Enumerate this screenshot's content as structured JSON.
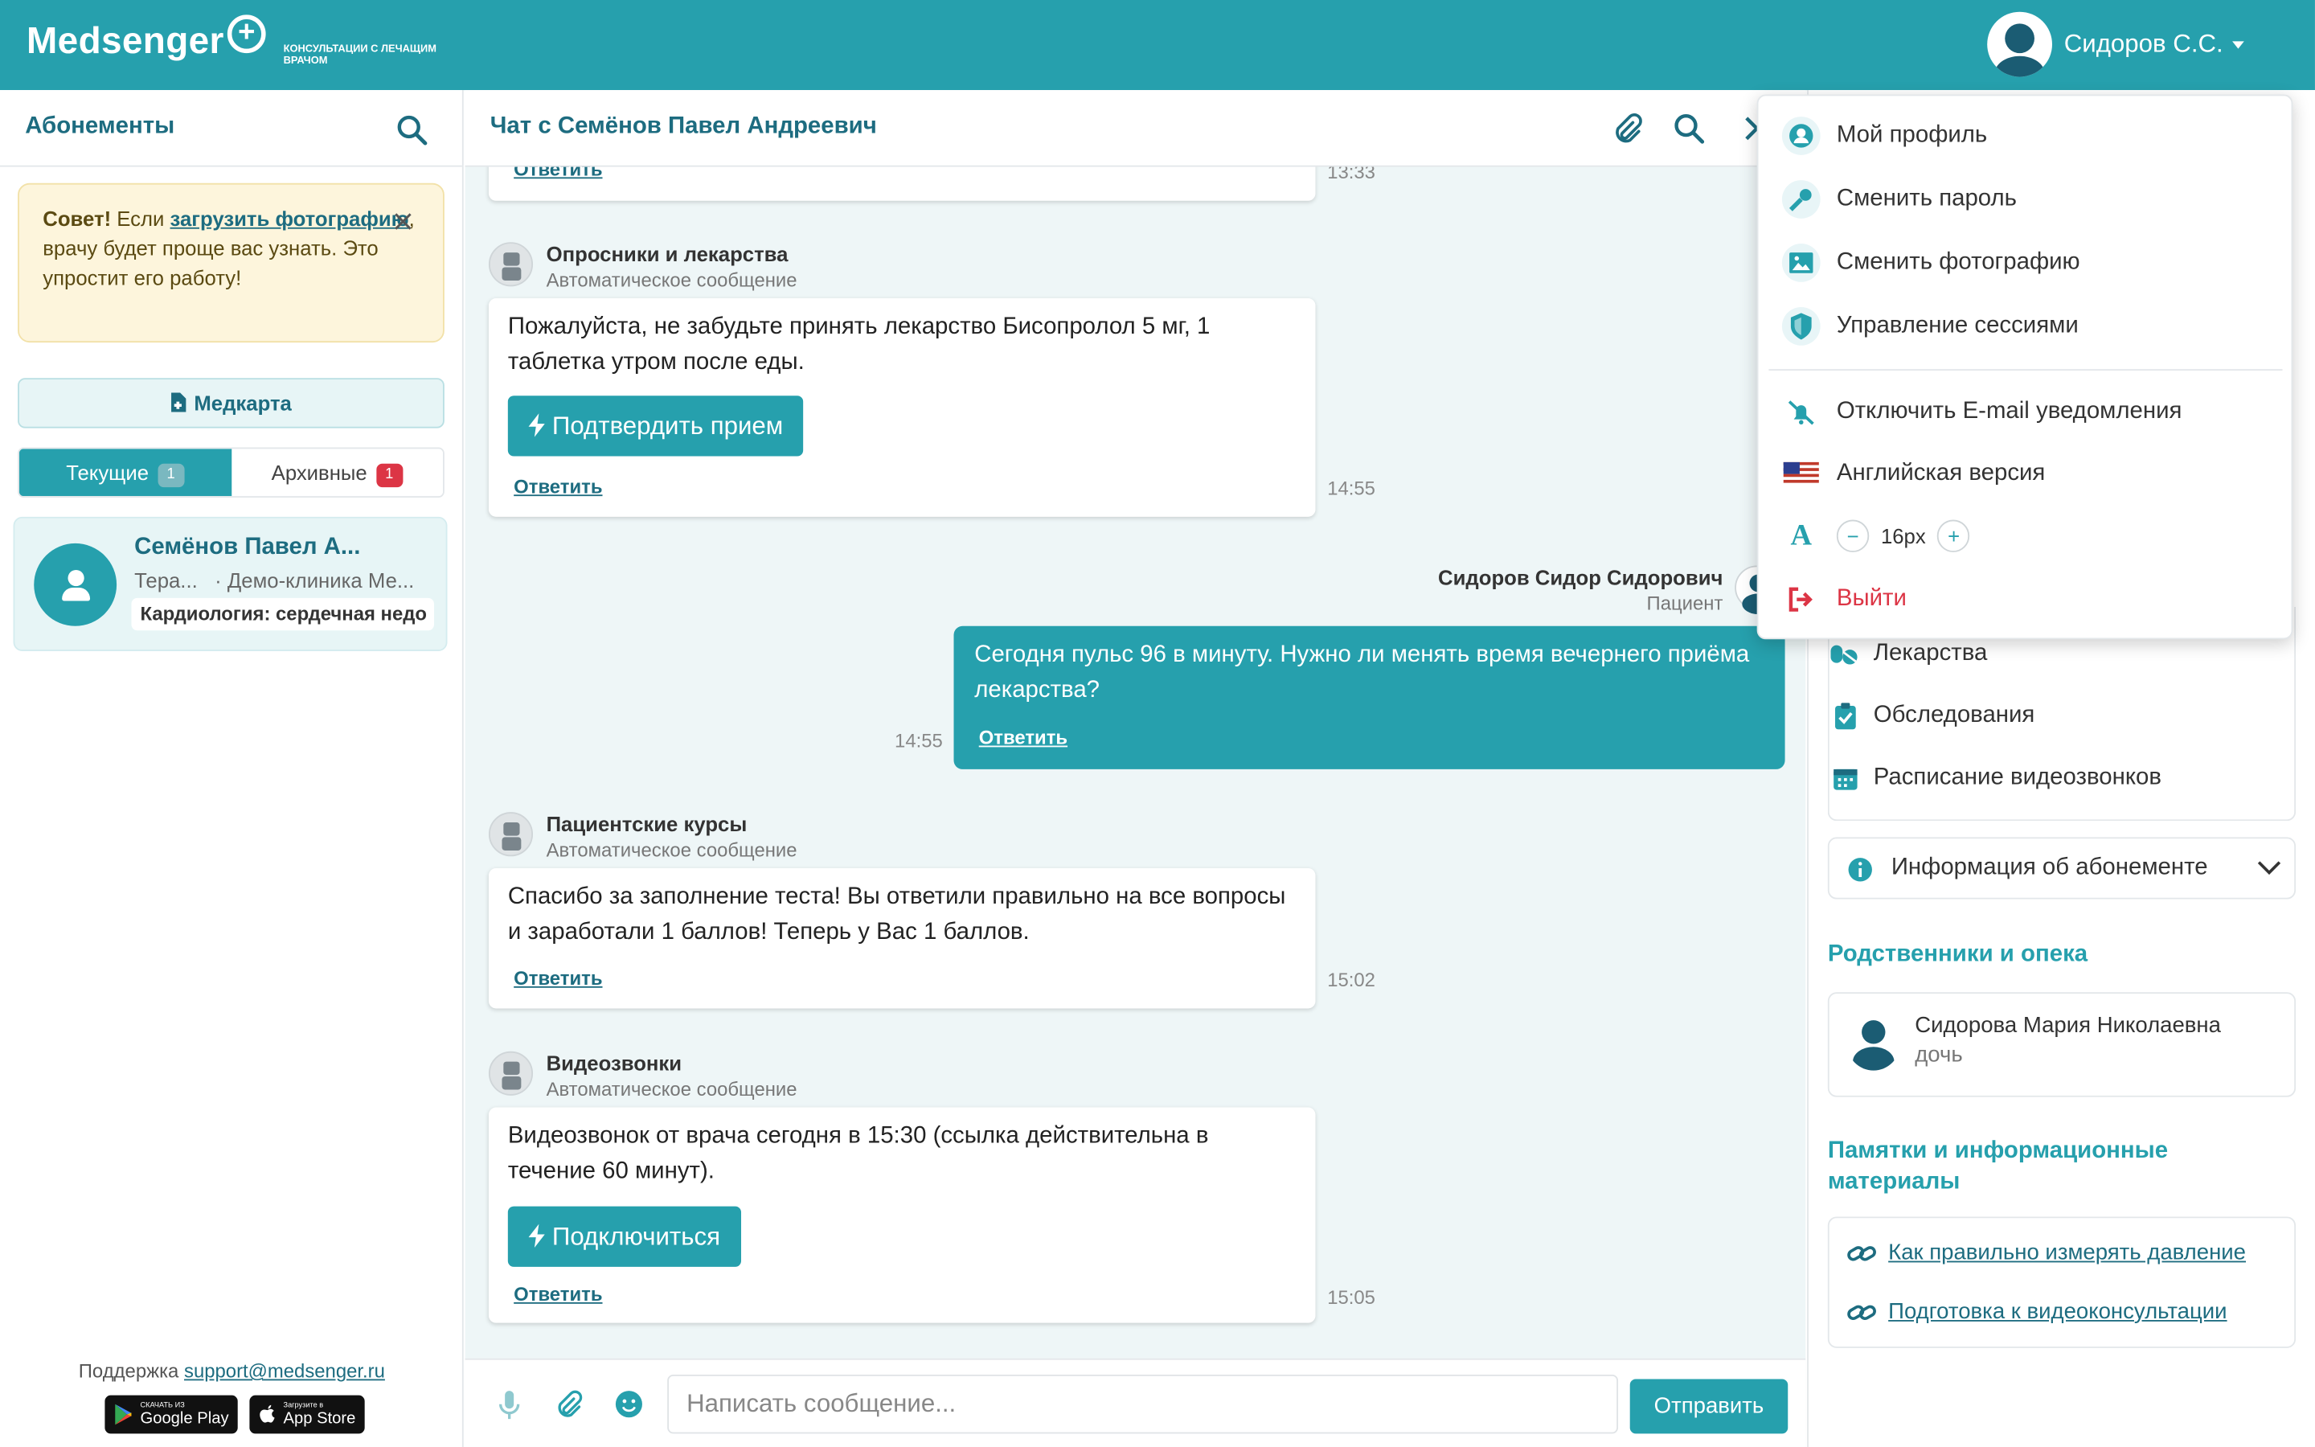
{
  "app": {
    "logo": "Medsenger",
    "logo_sub": "КОНСУЛЬТАЦИИ С ЛЕЧАЩИМ ВРАЧОМ",
    "user_name": "Сидоров С.С.",
    "accent_color": "#26a0ad",
    "dark_color": "#1d6c80"
  },
  "left": {
    "title": "Абонементы",
    "tip": {
      "bold": "Совет!",
      "pre": " Если ",
      "link": "загрузить фотографию",
      "post": ", врачу будет проще вас узнать. Это упростит его работу!"
    },
    "medcard_label": "Медкарта",
    "tabs": [
      {
        "label": "Текущие",
        "count": "1"
      },
      {
        "label": "Архивные",
        "count": "1"
      }
    ],
    "contact": {
      "name": "Семёнов Павел А...",
      "specialty": "Тера...",
      "clinic": "· Демо-клиника Ме...",
      "tag": "Кардиология: сердечная недо"
    },
    "support_label": "Поддержка",
    "support_email": "support@medsenger.ru",
    "stores": [
      {
        "small": "СКАЧАТЬ ИЗ",
        "big": "Google Play"
      },
      {
        "small": "Загрузите в",
        "big": "App Store"
      }
    ]
  },
  "chat": {
    "title": "Чат с Семёнов Павел Андреевич",
    "reply_label": "Ответить",
    "top_time": "13:33",
    "messages": [
      {
        "sender": "Опросники и лекарства",
        "sub": "Автоматическое сообщение",
        "text": "Пожалуйста, не забудьте принять лекарство Бисопролол 5 мг, 1 таблетка утром после еды.",
        "action": "Подтвердить прием",
        "time": "14:55"
      },
      {
        "sender": "Сидоров Сидор Сидорович",
        "sub": "Пациент",
        "text": "Сегодня пульс 96 в минуту. Нужно ли менять время вечернего приёма лекарства?",
        "time": "14:55"
      },
      {
        "sender": "Пациентские курсы",
        "sub": "Автоматическое сообщение",
        "text": "Спасибо за заполнение теста! Вы ответили правильно на все вопросы и заработали 1 баллов! Теперь у Вас 1 баллов.",
        "time": "15:02"
      },
      {
        "sender": "Видеозвонки",
        "sub": "Автоматическое сообщение",
        "text": "Видеозвонок от врача сегодня в 15:30 (ссылка действительна в течение 60 минут).",
        "action": "Подключиться",
        "time": "15:05"
      }
    ],
    "input_placeholder": "Написать сообщение...",
    "send_label": "Отправить"
  },
  "right": {
    "items": [
      "Лекарства",
      "Обследования",
      "Расписание видеозвонков"
    ],
    "info_label": "Информация об абонементе",
    "relatives_title": "Родственники и опека",
    "relative": {
      "name": "Сидорова Мария Николаевна",
      "role": "дочь"
    },
    "materials_title": "Памятки и информационные материалы",
    "links": [
      "Как правильно измерять давление",
      "Подготовка к видеоконсультации"
    ]
  },
  "dropdown": {
    "items": [
      "Мой профиль",
      "Сменить пароль",
      "Сменить фотографию",
      "Управление сессиями"
    ],
    "email_off": "Отключить E-mail уведомления",
    "english": "Английская версия",
    "font_size": "16px",
    "logout": "Выйти"
  }
}
